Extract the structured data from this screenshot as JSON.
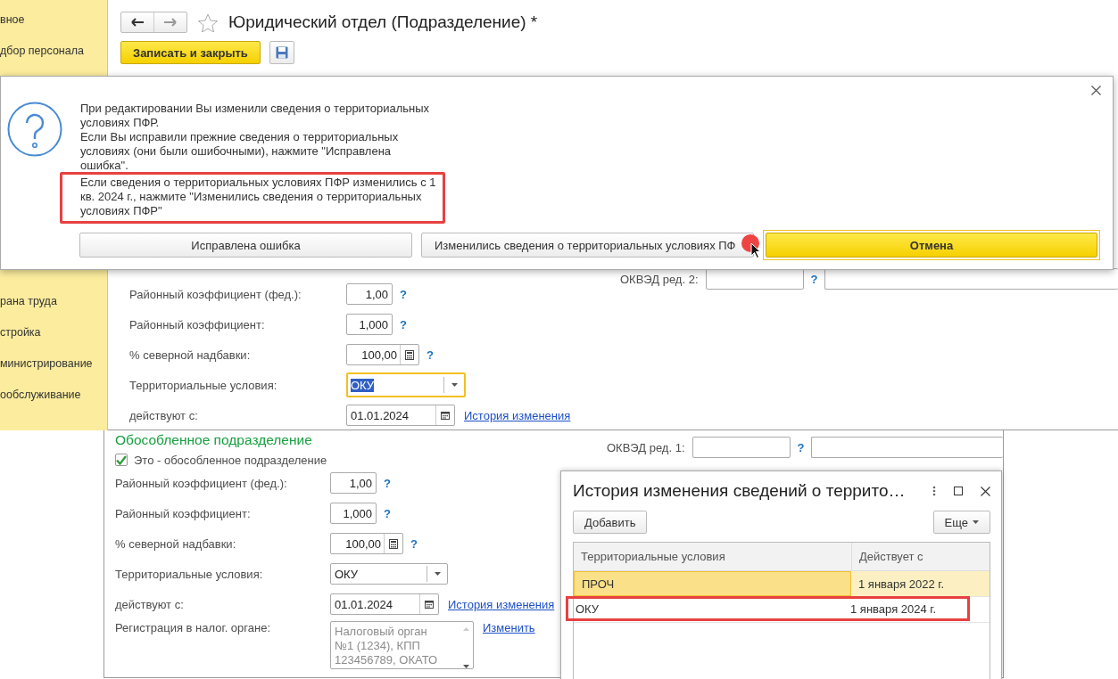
{
  "main_window": {
    "sidebar": {
      "items": [
        {
          "label": "вное"
        },
        {
          "label": "дбор персонала"
        }
      ],
      "lower_items": [
        {
          "label": "рана труда"
        },
        {
          "label": "стройка"
        },
        {
          "label": "министрирование"
        },
        {
          "label": "ообслуживание"
        }
      ]
    },
    "title": "Юридический отдел (Подразделение) *",
    "save_close_button": "Записать и закрыть",
    "form": {
      "rows": [
        {
          "kind": "number",
          "label": "Районный коэффициент (фед.):",
          "value": "1,00",
          "help": "?"
        },
        {
          "kind": "number",
          "label": "Районный коэффициент:",
          "value": "1,000",
          "help": "?"
        },
        {
          "kind": "calc",
          "label": "% северной надбавки:",
          "value": "100,00",
          "help": "?"
        },
        {
          "kind": "select",
          "label": "Территориальные условия:",
          "value": "ОКУ",
          "focused": true
        },
        {
          "kind": "date",
          "label": "действуют с:",
          "value": "01.01.2024",
          "link": "История изменения"
        }
      ],
      "okved": {
        "label": "ОКВЭД ред. 2:",
        "help": "?"
      }
    },
    "dialog": {
      "paragraphs": [
        {
          "text": "При редактировании Вы изменили сведения о территориальных условиях ПФР.",
          "highlighted": false
        },
        {
          "text": "Если Вы исправили прежние сведения о территориальных условиях (они были ошибочными), нажмите \"Исправлена ошибка\".",
          "highlighted": false
        },
        {
          "text": "Если сведения о территориальных условиях ПФР изменились с 1 кв. 2024 г., нажмите \"Изменились сведения о территориальных условиях ПФР\"",
          "highlighted": true
        }
      ],
      "buttons": [
        {
          "label": "Исправлена ошибка",
          "default": false,
          "pointer": false
        },
        {
          "label": "Изменились сведения о территориальных условиях ПФ",
          "default": false,
          "pointer": true
        },
        {
          "label": "Отмена",
          "default": true,
          "pointer": false
        }
      ]
    }
  },
  "second_window": {
    "section_title": "Обособленное подразделение",
    "checkbox": {
      "label": "Это - обособленное подразделение",
      "checked": true
    },
    "rows": [
      {
        "kind": "number",
        "label": "Районный коэффициент (фед.):",
        "value": "1,00",
        "help": "?"
      },
      {
        "kind": "number",
        "label": "Районный коэффициент:",
        "value": "1,000",
        "help": "?"
      },
      {
        "kind": "calc",
        "label": "% северной надбавки:",
        "value": "100,00",
        "help": "?"
      },
      {
        "kind": "select",
        "label": "Территориальные условия:",
        "value": "ОКУ",
        "focused": false
      },
      {
        "kind": "date",
        "label": "действуют с:",
        "value": "01.01.2024",
        "link": "История изменения"
      },
      {
        "kind": "textarea",
        "label": "Регистрация в налог. органе:",
        "value": "Налоговый орган №1 (1234), КПП 123456789, ОКАТО",
        "disabled": true,
        "link": "Изменить"
      }
    ],
    "okved": {
      "label": "ОКВЭД ред. 1:",
      "help": "?"
    },
    "history_window": {
      "title": "История изменения сведений о террито…",
      "add_button": "Добавить",
      "more_button": "Еще",
      "columns": [
        "Территориальные условия",
        "Действует с"
      ],
      "rows": [
        {
          "cells": [
            "ПРОЧ",
            "1 января 2022 г."
          ],
          "selected": true,
          "highlighted": false
        },
        {
          "cells": [
            "ОКУ",
            "1 января 2024 г."
          ],
          "selected": false,
          "highlighted": true
        }
      ]
    }
  }
}
